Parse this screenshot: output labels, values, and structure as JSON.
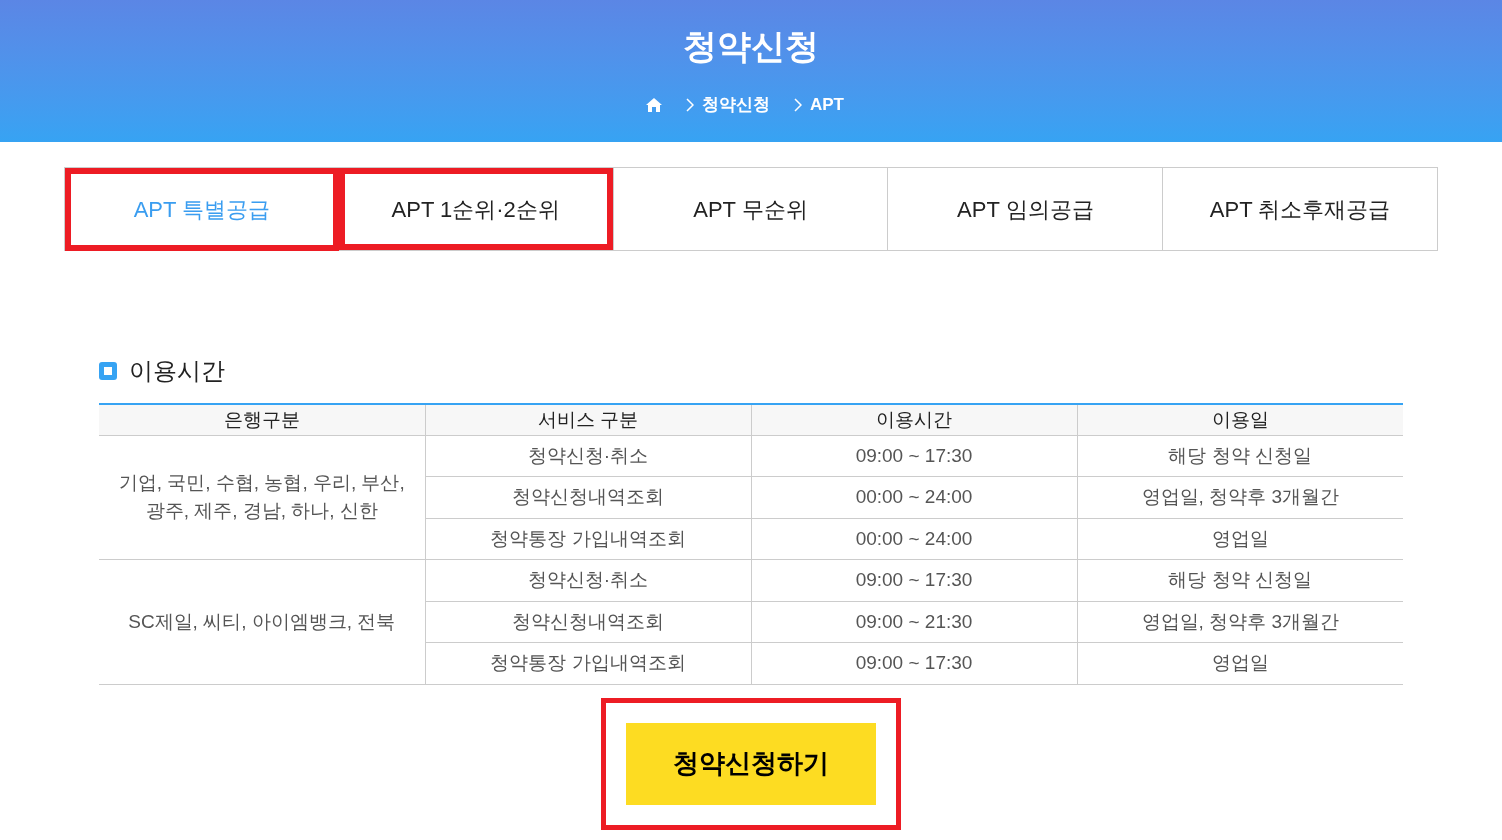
{
  "header": {
    "title": "청약신청",
    "breadcrumb": [
      "청약신청",
      "APT"
    ]
  },
  "tabs": [
    {
      "label": "APT 특별공급",
      "selected": true,
      "highlighted": true
    },
    {
      "label": "APT 1순위·2순위",
      "selected": false,
      "highlighted": true
    },
    {
      "label": "APT 무순위",
      "selected": false,
      "highlighted": false
    },
    {
      "label": "APT 임의공급",
      "selected": false,
      "highlighted": false
    },
    {
      "label": "APT 취소후재공급",
      "selected": false,
      "highlighted": false
    }
  ],
  "section": {
    "title": "이용시간"
  },
  "table": {
    "columns": [
      "은행구분",
      "서비스 구분",
      "이용시간",
      "이용일"
    ],
    "groups": [
      {
        "banks": "기업, 국민, 수협, 농협, 우리, 부산,\n광주, 제주, 경남, 하나, 신한",
        "rows": [
          {
            "service": "청약신청·취소",
            "time": "09:00 ~ 17:30",
            "days": "해당 청약 신청일"
          },
          {
            "service": "청약신청내역조회",
            "time": "00:00 ~ 24:00",
            "days": "영업일, 청약후 3개월간"
          },
          {
            "service": "청약통장 가입내역조회",
            "time": "00:00 ~ 24:00",
            "days": "영업일"
          }
        ]
      },
      {
        "banks": "SC제일, 씨티, 아이엠뱅크, 전북",
        "rows": [
          {
            "service": "청약신청·취소",
            "time": "09:00 ~ 17:30",
            "days": "해당 청약 신청일"
          },
          {
            "service": "청약신청내역조회",
            "time": "09:00 ~ 21:30",
            "days": "영업일, 청약후 3개월간"
          },
          {
            "service": "청약통장 가입내역조회",
            "time": "09:00 ~ 17:30",
            "days": "영업일"
          }
        ]
      }
    ]
  },
  "apply_button": {
    "label": "청약신청하기",
    "highlighted": true
  }
}
